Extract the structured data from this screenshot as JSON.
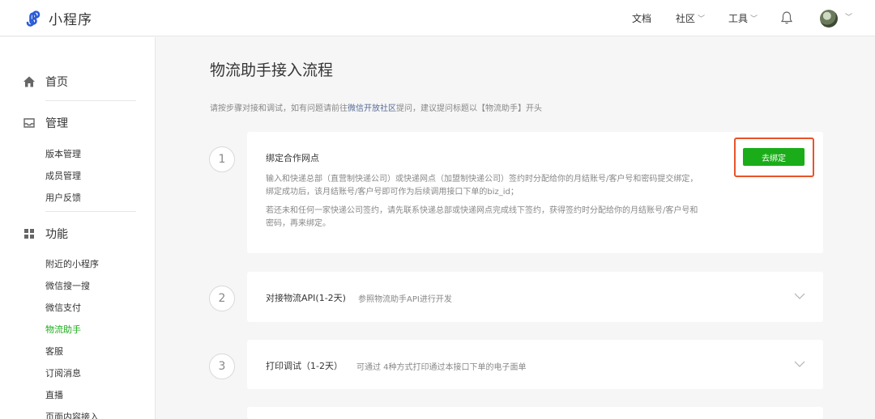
{
  "app": {
    "name": "小程序"
  },
  "header": {
    "nav": [
      {
        "label": "文档",
        "has_dropdown": false
      },
      {
        "label": "社区",
        "has_dropdown": true
      },
      {
        "label": "工具",
        "has_dropdown": true
      }
    ],
    "chevron": "﹀"
  },
  "sidebar": {
    "sections": [
      {
        "label": "首页",
        "icon": "home-icon"
      },
      {
        "label": "管理",
        "icon": "inbox-icon"
      },
      {
        "label": "功能",
        "icon": "grid-icon"
      }
    ],
    "manage_items": [
      "版本管理",
      "成员管理",
      "用户反馈"
    ],
    "feature_items": [
      "附近的小程序",
      "微信搜一搜",
      "微信支付",
      "物流助手",
      "客服",
      "订阅消息",
      "直播",
      "页面内容接入"
    ],
    "active_item": "物流助手"
  },
  "main": {
    "title": "物流助手接入流程",
    "desc_before": "请按步骤对接和调试，如有问题请前往",
    "desc_link": "微信开放社区",
    "desc_after": "提问，建议提问标题以【物流助手】开头",
    "steps": [
      {
        "number": "1",
        "title": "绑定合作网点",
        "paragraph1": "输入和快递总部（直营制快递公司）或快递网点（加盟制快递公司）签约时分配给你的月结账号/客户号和密码提交绑定， 绑定成功后，该月结账号/客户号即可作为后续调用接口下单的biz_id；",
        "paragraph2": "若还未和任何一家快递公司签约，请先联系快递总部或快递网点完成线下签约，获得签约时分配给你的月结账号/客户号和密码，再来绑定。",
        "button": "去绑定"
      },
      {
        "number": "2",
        "title": "对接物流API(1-2天)",
        "subtitle": "参照物流助手API进行开发"
      },
      {
        "number": "3",
        "title": "打印调试（1-2天）",
        "subtitle": "可通过 4种方式打印通过本接口下单的电子面单"
      }
    ]
  },
  "colors": {
    "accent": "#1aad19",
    "highlight": "#e8532a",
    "link": "#576b95"
  }
}
